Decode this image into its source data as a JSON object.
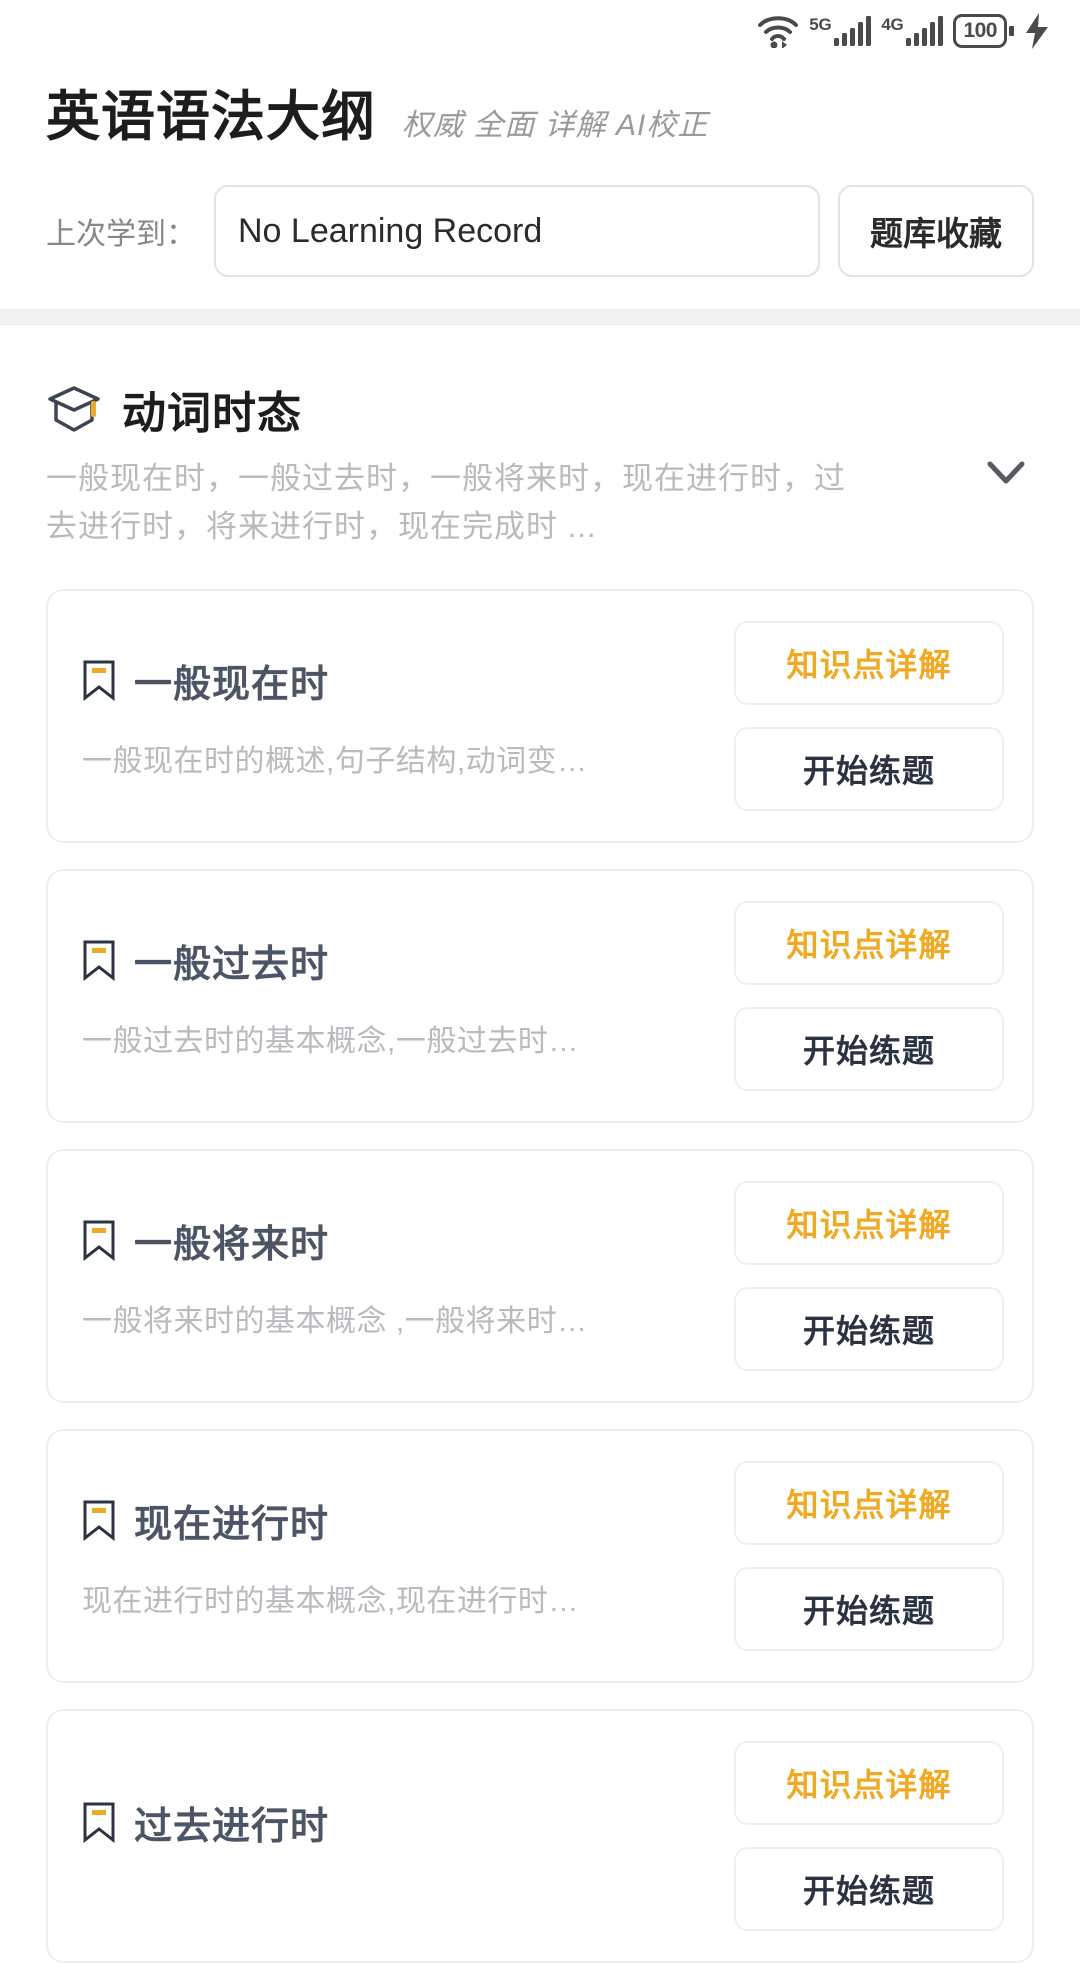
{
  "status_bar": {
    "wifi_icon": "wifi-icon",
    "network_1": "5G",
    "network_2": "4G",
    "battery_level": "100",
    "charging_icon": "charging-bolt-icon"
  },
  "header": {
    "title": "英语语法大纲",
    "subtitle": "权威 全面 详解 AI校正",
    "record_label": "上次学到：",
    "record_value": "No Learning Record",
    "favorites_button": "题库收藏"
  },
  "section": {
    "icon": "graduation-cap-icon",
    "title": "动词时态",
    "description": "一般现在时，一般过去时，一般将来时，现在进行时，过去进行时，将来进行时，现在完成时 ...",
    "collapse_icon": "chevron-down-icon"
  },
  "buttons": {
    "detail_label": "知识点详解",
    "practice_label": "开始练题"
  },
  "colors": {
    "accent_orange": "#f0a923",
    "title_dark": "#1d1d1f",
    "card_title": "#4c5566",
    "muted_gray": "#b9b9be"
  },
  "topics": [
    {
      "bookmark_icon": "bookmark-icon",
      "title": "一般现在时",
      "description": "一般现在时的概述,句子结构,动词变…"
    },
    {
      "bookmark_icon": "bookmark-icon",
      "title": "一般过去时",
      "description": "一般过去时的基本概念,一般过去时…"
    },
    {
      "bookmark_icon": "bookmark-icon",
      "title": "一般将来时",
      "description": "一般将来时的基本概念 ,一般将来时…"
    },
    {
      "bookmark_icon": "bookmark-icon",
      "title": "现在进行时",
      "description": "现在进行时的基本概念,现在进行时…"
    },
    {
      "bookmark_icon": "bookmark-icon",
      "title": "过去进行时",
      "description": ""
    }
  ]
}
